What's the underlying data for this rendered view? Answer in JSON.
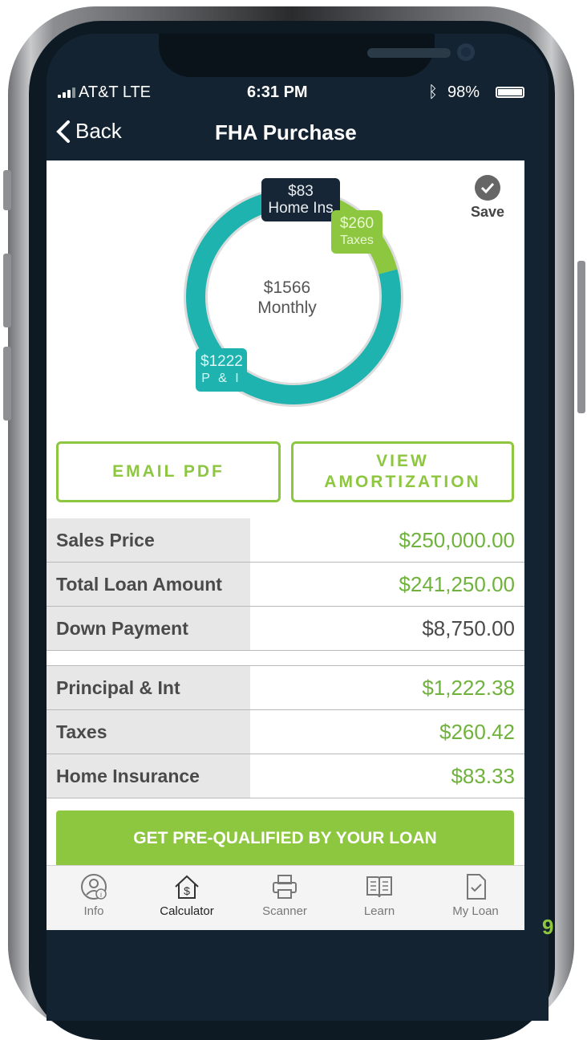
{
  "status_bar": {
    "carrier": "AT&T  LTE",
    "time": "6:31 PM",
    "battery": "98%"
  },
  "nav": {
    "back_label": "Back",
    "title": "FHA Purchase"
  },
  "save_label": "Save",
  "chart_data": {
    "type": "pie",
    "categories": [
      "P & I",
      "Taxes",
      "Home Ins"
    ],
    "values": [
      1222,
      260,
      83
    ],
    "colors": [
      "#1fb3b0",
      "#8dc63f",
      "#162636"
    ],
    "center_value": "$1566",
    "center_label": "Monthly",
    "labels": [
      {
        "value": "$1222",
        "name": "P & I"
      },
      {
        "value": "$260",
        "name": "Taxes"
      },
      {
        "value": "$83",
        "name": "Home Ins"
      }
    ]
  },
  "buttons": {
    "email_pdf": "EMAIL PDF",
    "view_amortization": "VIEW AMORTIZATION"
  },
  "rows": [
    {
      "label": "Sales Price",
      "value": "$250,000.00"
    },
    {
      "label": "Total Loan Amount",
      "value": "$241,250.00"
    },
    {
      "label": "Down Payment",
      "value": "$8,750.00"
    },
    {
      "label": "Principal & Int",
      "value": "$1,222.38"
    },
    {
      "label": "Taxes",
      "value": "$260.42"
    },
    {
      "label": "Home Insurance",
      "value": "$83.33"
    }
  ],
  "prequal_button": "GET PRE-QUALIFIED BY YOUR LOAN",
  "tabs": [
    {
      "label": "Info",
      "icon": "info-icon"
    },
    {
      "label": "Calculator",
      "icon": "calculator-house-icon"
    },
    {
      "label": "Scanner",
      "icon": "scanner-icon"
    },
    {
      "label": "Learn",
      "icon": "book-icon"
    },
    {
      "label": "My Loan",
      "icon": "document-check-icon"
    }
  ],
  "page_number": "9"
}
